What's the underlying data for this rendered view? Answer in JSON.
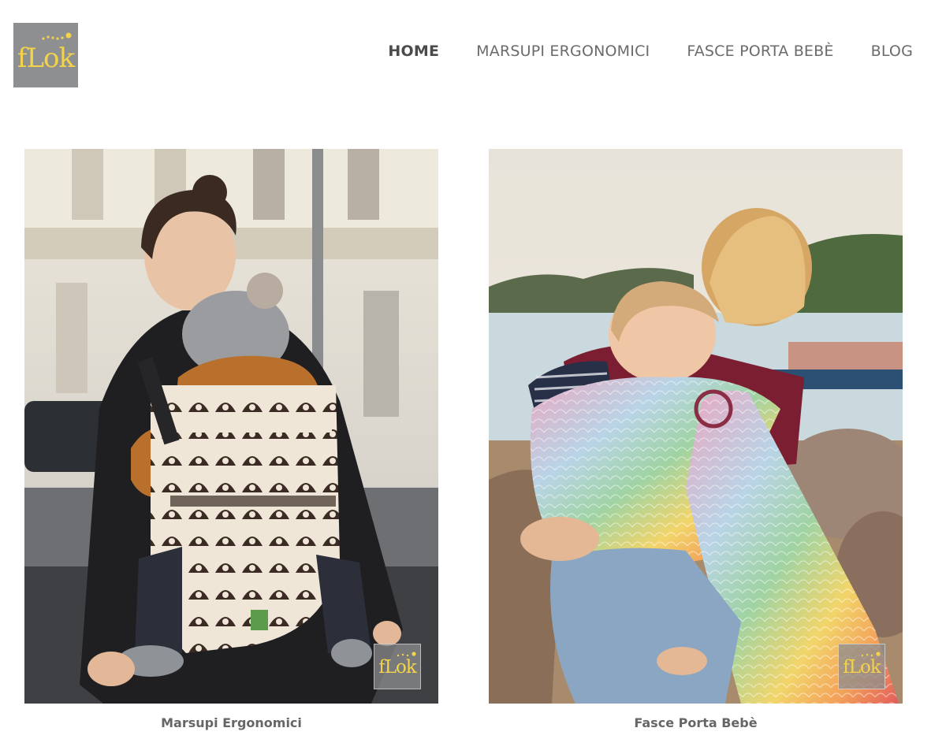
{
  "logo": {
    "text": "fLok",
    "icon": "flok-logo"
  },
  "nav": {
    "items": [
      {
        "label": "HOME",
        "active": true
      },
      {
        "label": "MARSUPI ERGONOMICI",
        "active": false
      },
      {
        "label": "FASCE PORTA BEBÈ",
        "active": false
      },
      {
        "label": "BLOG",
        "active": false
      }
    ]
  },
  "cards": [
    {
      "caption": "Marsupi Ergonomici",
      "badge": "fLok",
      "image": "woman-with-ergonomic-baby-carrier-photo"
    },
    {
      "caption": "Fasce Porta Bebè",
      "badge": "fLok",
      "image": "woman-with-rainbow-ring-sling-photo"
    }
  ],
  "colors": {
    "logo_bg": "#8e8f91",
    "logo_text": "#f2d34a",
    "nav_text": "#6b6b6b",
    "nav_active": "#4b4b4b",
    "caption_text": "#666666"
  }
}
